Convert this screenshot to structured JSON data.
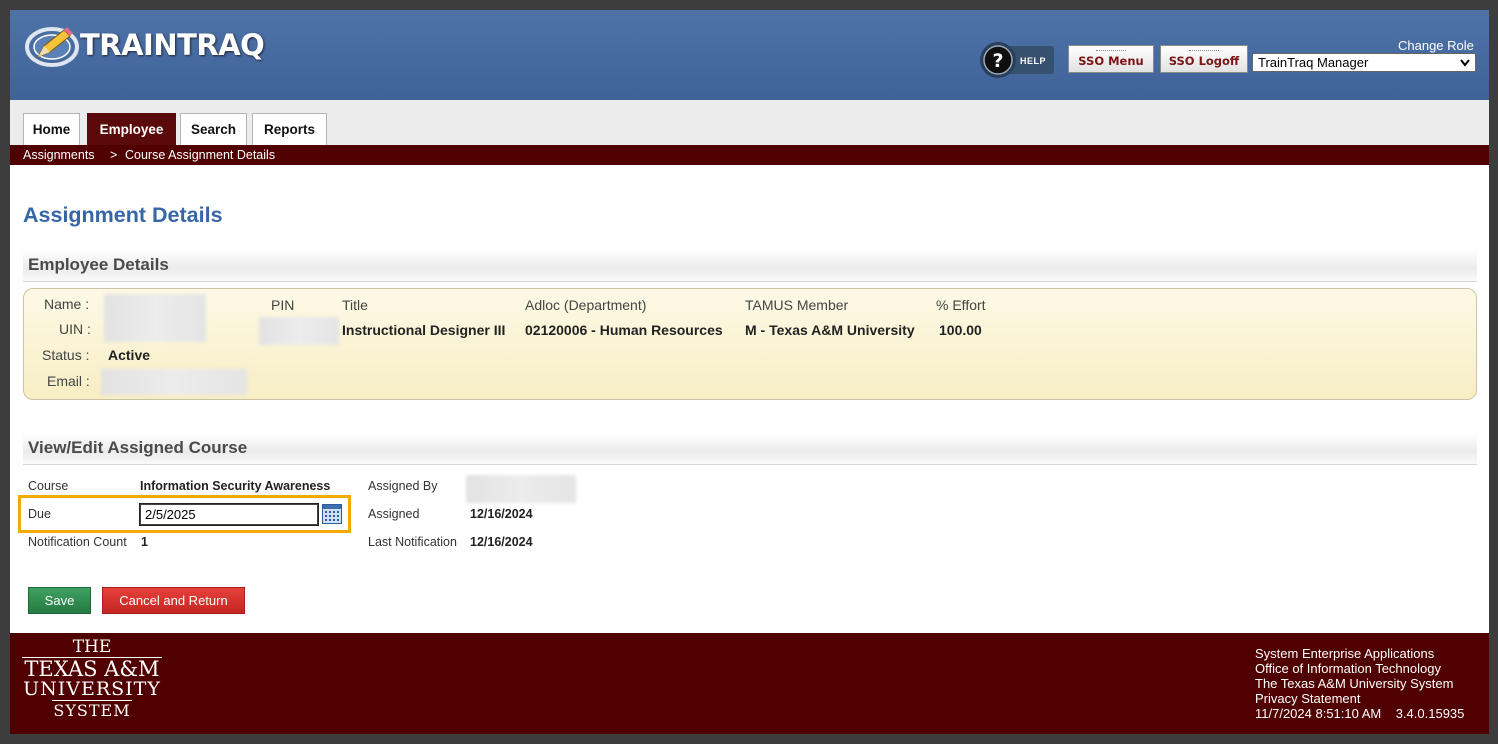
{
  "header": {
    "app_name": "TRAINTRAQ",
    "help_label": "HELP",
    "sso_menu_label": "SSO Menu",
    "sso_logoff_label": "SSO Logoff",
    "change_role_label": "Change Role",
    "role_selected": "TrainTraq Manager"
  },
  "nav": {
    "tabs": [
      {
        "label": "Home"
      },
      {
        "label": "Employee"
      },
      {
        "label": "Search"
      },
      {
        "label": "Reports"
      }
    ],
    "active_tab": "Employee"
  },
  "breadcrumb": {
    "parent": "Assignments",
    "separator": ">",
    "current": "Course Assignment Details"
  },
  "page_title": "Assignment Details",
  "employee_section": {
    "heading": "Employee Details",
    "name_label": "Name :",
    "uin_label": "UIN :",
    "status_label": "Status :",
    "status_value": "Active",
    "email_label": "Email :",
    "columns": {
      "pin": "PIN",
      "title": "Title",
      "adloc": "Adloc (Department)",
      "tamus_member": "TAMUS Member",
      "effort": "% Effort"
    },
    "row": {
      "title": "Instructional Designer III",
      "adloc": "02120006 - Human Resources",
      "tamus_member": "M - Texas A&M University",
      "effort": "100.00"
    }
  },
  "course_section": {
    "heading": "View/Edit Assigned Course",
    "course_label": "Course",
    "course_value": "Information Security Awareness",
    "due_label": "Due",
    "due_value": "2/5/2025",
    "notification_count_label": "Notification Count",
    "notification_count_value": "1",
    "assigned_by_label": "Assigned By",
    "assigned_label": "Assigned",
    "assigned_value": "12/16/2024",
    "last_notification_label": "Last Notification",
    "last_notification_value": "12/16/2024",
    "highlight_color": "#f2a900"
  },
  "buttons": {
    "save": "Save",
    "cancel": "Cancel and Return"
  },
  "footer": {
    "logo_lines": [
      "THE",
      "TEXAS A&M",
      "UNIVERSITY",
      "SYSTEM"
    ],
    "links": [
      "System Enterprise Applications",
      "Office of Information Technology",
      "The Texas A&M University System",
      "Privacy Statement"
    ],
    "timestamp": "11/7/2024 8:51:10 AM",
    "version": "3.4.0.15935"
  },
  "colors": {
    "header_blue": "#4a6fa5",
    "maroon": "#500000",
    "title_blue": "#3766a8",
    "save_green": "#2f8a4f",
    "cancel_red": "#d6302c"
  }
}
